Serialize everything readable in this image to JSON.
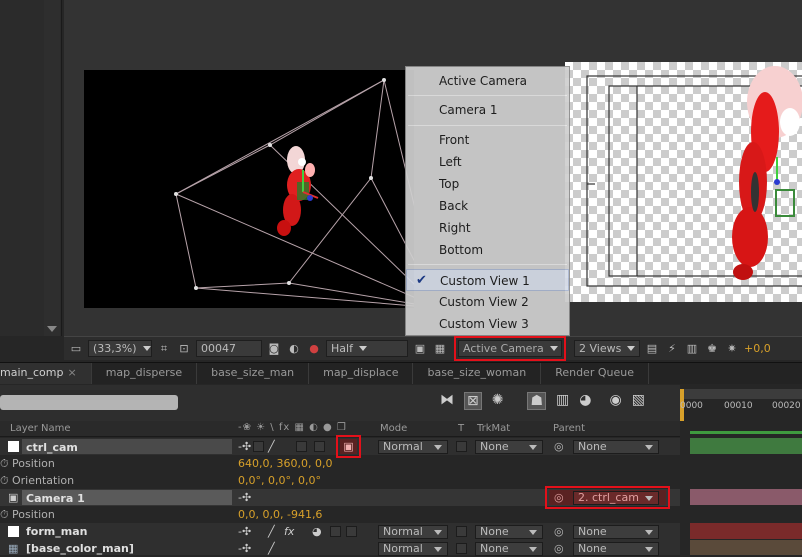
{
  "comp_view_bar": {
    "zoom": "(33,3%)",
    "timecode": "00047",
    "resolution": "Half",
    "view": "Active Camera",
    "layout": "2 Views",
    "exposure": "+0,0"
  },
  "view_menu": {
    "items": [
      "Active Camera",
      "Camera 1",
      "Front",
      "Left",
      "Top",
      "Back",
      "Right",
      "Bottom",
      "Custom View 1",
      "Custom View 2",
      "Custom View 3"
    ],
    "checked": "Custom View 1"
  },
  "tabs": [
    "main_comp",
    "map_disperse",
    "base_size_man",
    "map_displace",
    "base_size_woman",
    "Render Queue"
  ],
  "columns": {
    "layer_name": "Layer Name",
    "switches": "-❀ ☀ \\ fx ▦ ◐ ● ❒",
    "mode": "Mode",
    "t": "T",
    "trkmat": "TrkMat",
    "parent": "Parent"
  },
  "ruler": {
    "t0": "0000",
    "t1": "00010",
    "t2": "00020"
  },
  "layers": {
    "ctrl_cam": {
      "name": "ctrl_cam",
      "mode": "Normal",
      "trkmat": "None",
      "parent": "None"
    },
    "ctrl_cam_position": {
      "label": "Position",
      "value": "640,0, 360,0, 0,0"
    },
    "ctrl_cam_orientation": {
      "label": "Orientation",
      "value": "0,0°, 0,0°, 0,0°"
    },
    "camera1": {
      "name": "Camera 1",
      "parent": "2. ctrl_cam"
    },
    "camera1_position": {
      "label": "Position",
      "value": "0,0, 0,0, -941,6"
    },
    "form_man": {
      "name": "form_man",
      "mode": "Normal",
      "trkmat": "None",
      "parent": "None"
    },
    "base_color_man": {
      "name": "[base_color_man]",
      "mode": "Normal",
      "trkmat": "None",
      "parent": "None"
    }
  },
  "colors": {
    "highlight": "#e3101a",
    "value": "#d7a02a",
    "bar_green": "#3f7a3f",
    "bar_pink": "#8a5a6a",
    "bar_red": "#7a2a2a"
  }
}
